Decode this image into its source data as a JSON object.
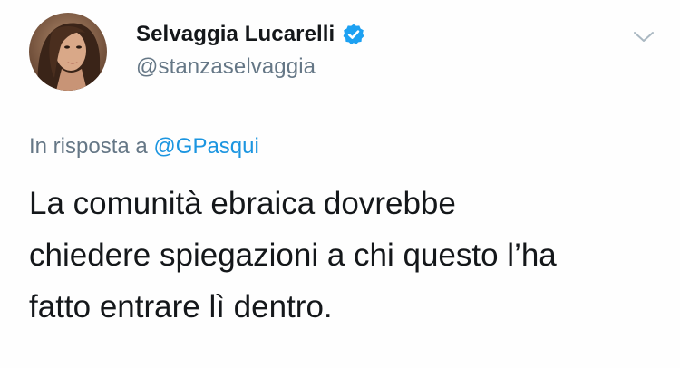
{
  "author": {
    "display_name": "Selvaggia Lucarelli",
    "handle": "@stanzaselvaggia",
    "verified": true
  },
  "reply": {
    "prefix": "In risposta a",
    "mention": "@GPasqui"
  },
  "tweet": {
    "lines": [
      "La comunità ebraica dovrebbe",
      "chiedere spiegazioni a chi questo l’ha",
      "fatto entrare lì dentro."
    ]
  },
  "icons": {
    "verified": "verified-badge-icon",
    "menu": "chevron-down-icon"
  },
  "colors": {
    "text": "#14171a",
    "secondary": "#657786",
    "link": "#1b95e0",
    "verified": "#1da1f2"
  }
}
